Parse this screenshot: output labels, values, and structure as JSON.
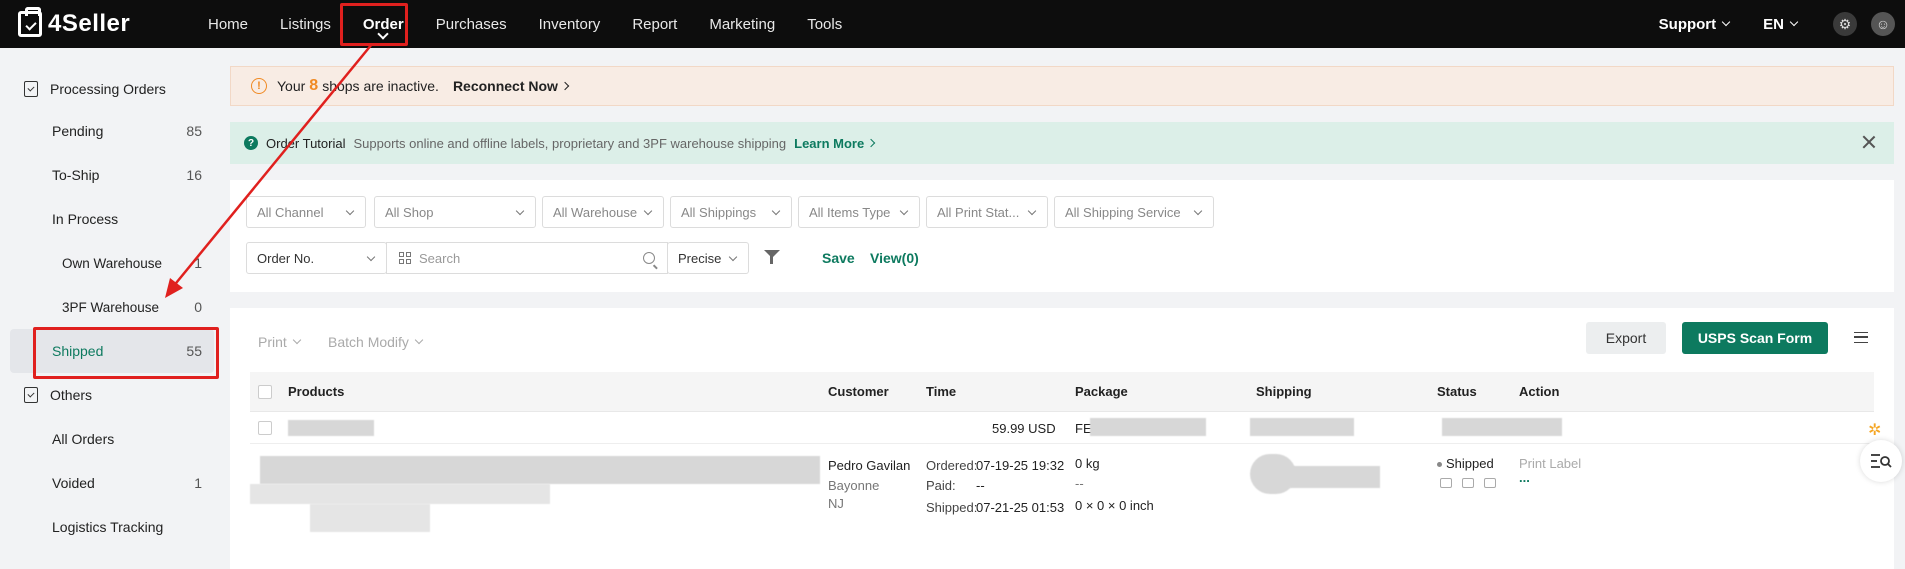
{
  "app": {
    "logo_text": "4Seller"
  },
  "nav": {
    "items": [
      "Home",
      "Listings",
      "Order",
      "Purchases",
      "Inventory",
      "Report",
      "Marketing",
      "Tools"
    ],
    "support": "Support",
    "lang": "EN"
  },
  "sidebar": {
    "processing_title": "Processing Orders",
    "pending": {
      "label": "Pending",
      "count": "85"
    },
    "to_ship": {
      "label": "To-Ship",
      "count": "16"
    },
    "in_process": {
      "label": "In Process"
    },
    "own_warehouse": {
      "label": "Own Warehouse",
      "count": "1"
    },
    "pf_warehouse": {
      "label": "3PF Warehouse",
      "count": "0"
    },
    "shipped": {
      "label": "Shipped",
      "count": "55"
    },
    "others_title": "Others",
    "all_orders": {
      "label": "All Orders"
    },
    "voided": {
      "label": "Voided",
      "count": "1"
    },
    "logistics": {
      "label": "Logistics Tracking"
    }
  },
  "banner": {
    "prefix": "Your",
    "count": "8",
    "suffix": "shops are inactive.",
    "action": "Reconnect Now"
  },
  "tutorial": {
    "title": "Order Tutorial",
    "desc": "Supports online and offline labels, proprietary and 3PF warehouse shipping",
    "link": "Learn More"
  },
  "filters": {
    "channel": "All Channel",
    "shop": "All Shop",
    "warehouse": "All Warehouse",
    "shippings": "All Shippings",
    "items_type": "All Items Type",
    "print_status": "All Print Stat...",
    "shipping_service": "All Shipping Service",
    "order_no": "Order No.",
    "search_placeholder": "Search",
    "precise": "Precise",
    "save": "Save",
    "view": "View(0)"
  },
  "toolbar": {
    "print": "Print",
    "batch_modify": "Batch Modify",
    "export": "Export",
    "usps_scan": "USPS Scan Form"
  },
  "table": {
    "headers": {
      "products": "Products",
      "customer": "Customer",
      "time": "Time",
      "package": "Package",
      "shipping": "Shipping",
      "status": "Status",
      "action": "Action"
    },
    "group_row": {
      "amount": "59.99 USD",
      "package_prefix": "FE"
    },
    "row": {
      "customer_name": "Pedro Gavilan",
      "customer_city": "Bayonne",
      "customer_state": "NJ",
      "ordered_label": "Ordered:",
      "ordered_value": "07-19-25 19:32",
      "paid_label": "Paid:",
      "paid_value": "--",
      "shipped_label": "Shipped:",
      "shipped_value": "07-21-25 01:53",
      "weight": "0 kg",
      "dash": "--",
      "dimensions": "0 × 0 × 0 inch",
      "status": "Shipped",
      "print_label": "Print Label",
      "more": "..."
    }
  },
  "colors": {
    "brand": "#0d7a5f",
    "warning": "#f08a24",
    "annotation": "#e0201e"
  }
}
